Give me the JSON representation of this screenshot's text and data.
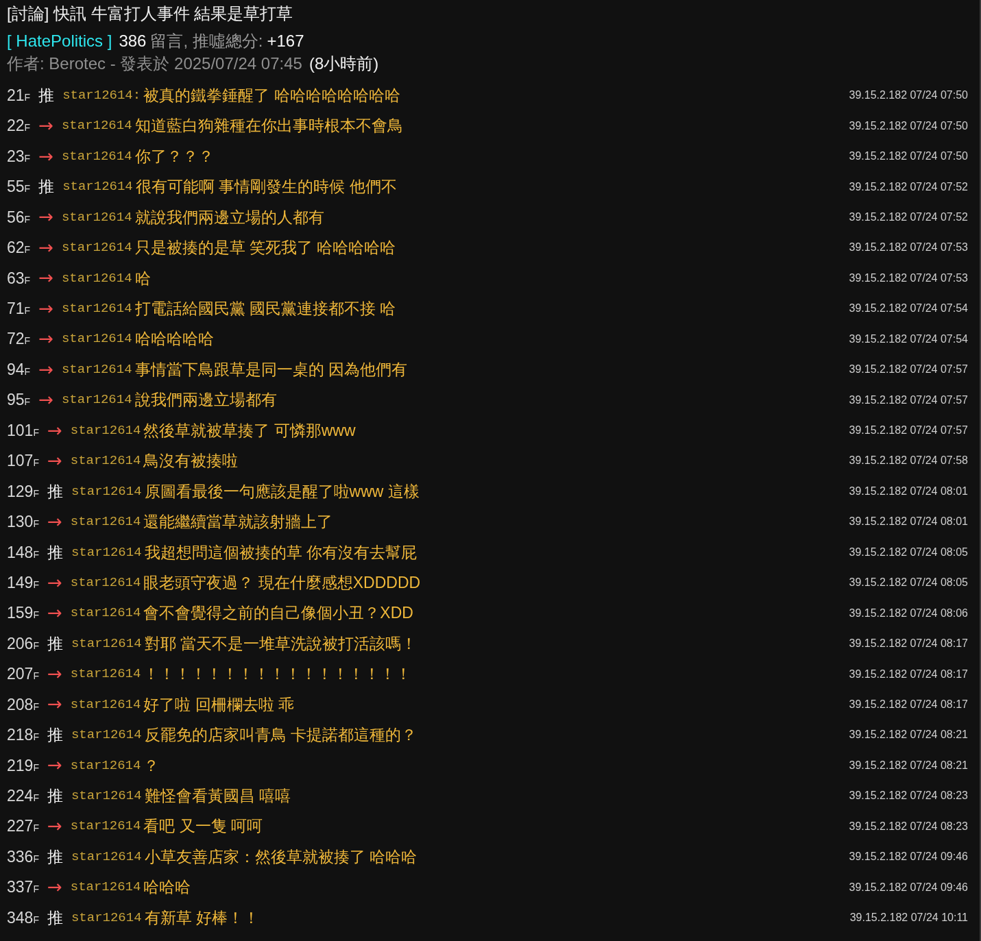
{
  "title": "[討論] 快訊 牛富打人事件 結果是草打草",
  "meta": {
    "board": "[ HatePolitics ]",
    "count": "386",
    "count_label": "留言, 推噓總分:",
    "score": "+167"
  },
  "byline": {
    "text": "作者: Berotec - 發表於 2025/07/24 07:45",
    "ago": "(8小時前)"
  },
  "comments": [
    {
      "floor": "21",
      "floor_mark": "F",
      "kind": "push",
      "tag": "推",
      "user": "star12614:",
      "text": "被真的鐵拳錘醒了 哈哈哈哈哈哈哈哈",
      "time": "39.15.2.182 07/24 07:50"
    },
    {
      "floor": "22",
      "floor_mark": "F",
      "kind": "arrow",
      "tag": "→",
      "user": "star12614",
      "text": "知道藍白狗雜種在你出事時根本不會鳥",
      "time": "39.15.2.182 07/24 07:50"
    },
    {
      "floor": "23",
      "floor_mark": "F",
      "kind": "arrow",
      "tag": "→",
      "user": "star12614",
      "text": "你了？？？",
      "time": "39.15.2.182 07/24 07:50"
    },
    {
      "floor": "55",
      "floor_mark": "F",
      "kind": "push",
      "tag": "推",
      "user": "star12614",
      "text": "很有可能啊 事情剛發生的時候 他們不",
      "time": "39.15.2.182 07/24 07:52"
    },
    {
      "floor": "56",
      "floor_mark": "F",
      "kind": "arrow",
      "tag": "→",
      "user": "star12614",
      "text": "就說我們兩邊立場的人都有",
      "time": "39.15.2.182 07/24 07:52"
    },
    {
      "floor": "62",
      "floor_mark": "F",
      "kind": "arrow",
      "tag": "→",
      "user": "star12614",
      "text": "只是被揍的是草 笑死我了 哈哈哈哈哈",
      "time": "39.15.2.182 07/24 07:53"
    },
    {
      "floor": "63",
      "floor_mark": "F",
      "kind": "arrow",
      "tag": "→",
      "user": "star12614",
      "text": "哈",
      "time": "39.15.2.182 07/24 07:53"
    },
    {
      "floor": "71",
      "floor_mark": "F",
      "kind": "arrow",
      "tag": "→",
      "user": "star12614",
      "text": "打電話給國民黨 國民黨連接都不接 哈",
      "time": "39.15.2.182 07/24 07:54"
    },
    {
      "floor": "72",
      "floor_mark": "F",
      "kind": "arrow",
      "tag": "→",
      "user": "star12614",
      "text": "哈哈哈哈哈",
      "time": "39.15.2.182 07/24 07:54"
    },
    {
      "floor": "94",
      "floor_mark": "F",
      "kind": "arrow",
      "tag": "→",
      "user": "star12614",
      "text": "事情當下鳥跟草是同一桌的 因為他們有",
      "time": "39.15.2.182 07/24 07:57"
    },
    {
      "floor": "95",
      "floor_mark": "F",
      "kind": "arrow",
      "tag": "→",
      "user": "star12614",
      "text": "說我們兩邊立場都有",
      "time": "39.15.2.182 07/24 07:57"
    },
    {
      "floor": "101",
      "floor_mark": "F",
      "kind": "arrow",
      "tag": "→",
      "user": "star12614",
      "text": "然後草就被草揍了 可憐那www",
      "time": "39.15.2.182 07/24 07:57"
    },
    {
      "floor": "107",
      "floor_mark": "F",
      "kind": "arrow",
      "tag": "→",
      "user": "star12614",
      "text": "鳥沒有被揍啦",
      "time": "39.15.2.182 07/24 07:58"
    },
    {
      "floor": "129",
      "floor_mark": "F",
      "kind": "push",
      "tag": "推",
      "user": "star12614",
      "text": "原圖看最後一句應該是醒了啦www 這樣",
      "time": "39.15.2.182 07/24 08:01"
    },
    {
      "floor": "130",
      "floor_mark": "F",
      "kind": "arrow",
      "tag": "→",
      "user": "star12614",
      "text": "還能繼續當草就該射牆上了",
      "time": "39.15.2.182 07/24 08:01"
    },
    {
      "floor": "148",
      "floor_mark": "F",
      "kind": "push",
      "tag": "推",
      "user": "star12614",
      "text": "我超想問這個被揍的草 你有沒有去幫屁",
      "time": "39.15.2.182 07/24 08:05"
    },
    {
      "floor": "149",
      "floor_mark": "F",
      "kind": "arrow",
      "tag": "→",
      "user": "star12614",
      "text": "眼老頭守夜過？ 現在什麼感想XDDDDD",
      "time": "39.15.2.182 07/24 08:05"
    },
    {
      "floor": "159",
      "floor_mark": "F",
      "kind": "arrow",
      "tag": "→",
      "user": "star12614",
      "text": "會不會覺得之前的自己像個小丑？XDD",
      "time": "39.15.2.182 07/24 08:06"
    },
    {
      "floor": "206",
      "floor_mark": "F",
      "kind": "push",
      "tag": "推",
      "user": "star12614",
      "text": "對耶 當天不是一堆草洗說被打活該嗎！",
      "time": "39.15.2.182 07/24 08:17"
    },
    {
      "floor": "207",
      "floor_mark": "F",
      "kind": "arrow",
      "tag": "→",
      "user": "star12614",
      "text": "！！！！！！！！！！！！！！！！！",
      "time": "39.15.2.182 07/24 08:17"
    },
    {
      "floor": "208",
      "floor_mark": "F",
      "kind": "arrow",
      "tag": "→",
      "user": "star12614",
      "text": "好了啦 回柵欄去啦 乖",
      "time": "39.15.2.182 07/24 08:17"
    },
    {
      "floor": "218",
      "floor_mark": "F",
      "kind": "push",
      "tag": "推",
      "user": "star12614",
      "text": "反罷免的店家叫青鳥 卡提諾都這種的？",
      "time": "39.15.2.182 07/24 08:21"
    },
    {
      "floor": "219",
      "floor_mark": "F",
      "kind": "arrow",
      "tag": "→",
      "user": "star12614",
      "text": "？",
      "time": "39.15.2.182 07/24 08:21"
    },
    {
      "floor": "224",
      "floor_mark": "F",
      "kind": "push",
      "tag": "推",
      "user": "star12614",
      "text": "難怪會看黃國昌 嘻嘻",
      "time": "39.15.2.182 07/24 08:23"
    },
    {
      "floor": "227",
      "floor_mark": "F",
      "kind": "arrow",
      "tag": "→",
      "user": "star12614",
      "text": "看吧 又一隻 呵呵",
      "time": "39.15.2.182 07/24 08:23"
    },
    {
      "floor": "336",
      "floor_mark": "F",
      "kind": "push",
      "tag": "推",
      "user": "star12614",
      "text": "小草友善店家：然後草就被揍了 哈哈哈",
      "time": "39.15.2.182 07/24 09:46"
    },
    {
      "floor": "337",
      "floor_mark": "F",
      "kind": "arrow",
      "tag": "→",
      "user": "star12614",
      "text": "哈哈哈",
      "time": "39.15.2.182 07/24 09:46"
    },
    {
      "floor": "348",
      "floor_mark": "F",
      "kind": "push",
      "tag": "推",
      "user": "star12614",
      "text": "有新草 好棒！！",
      "time": "39.15.2.182 07/24 10:11"
    }
  ]
}
